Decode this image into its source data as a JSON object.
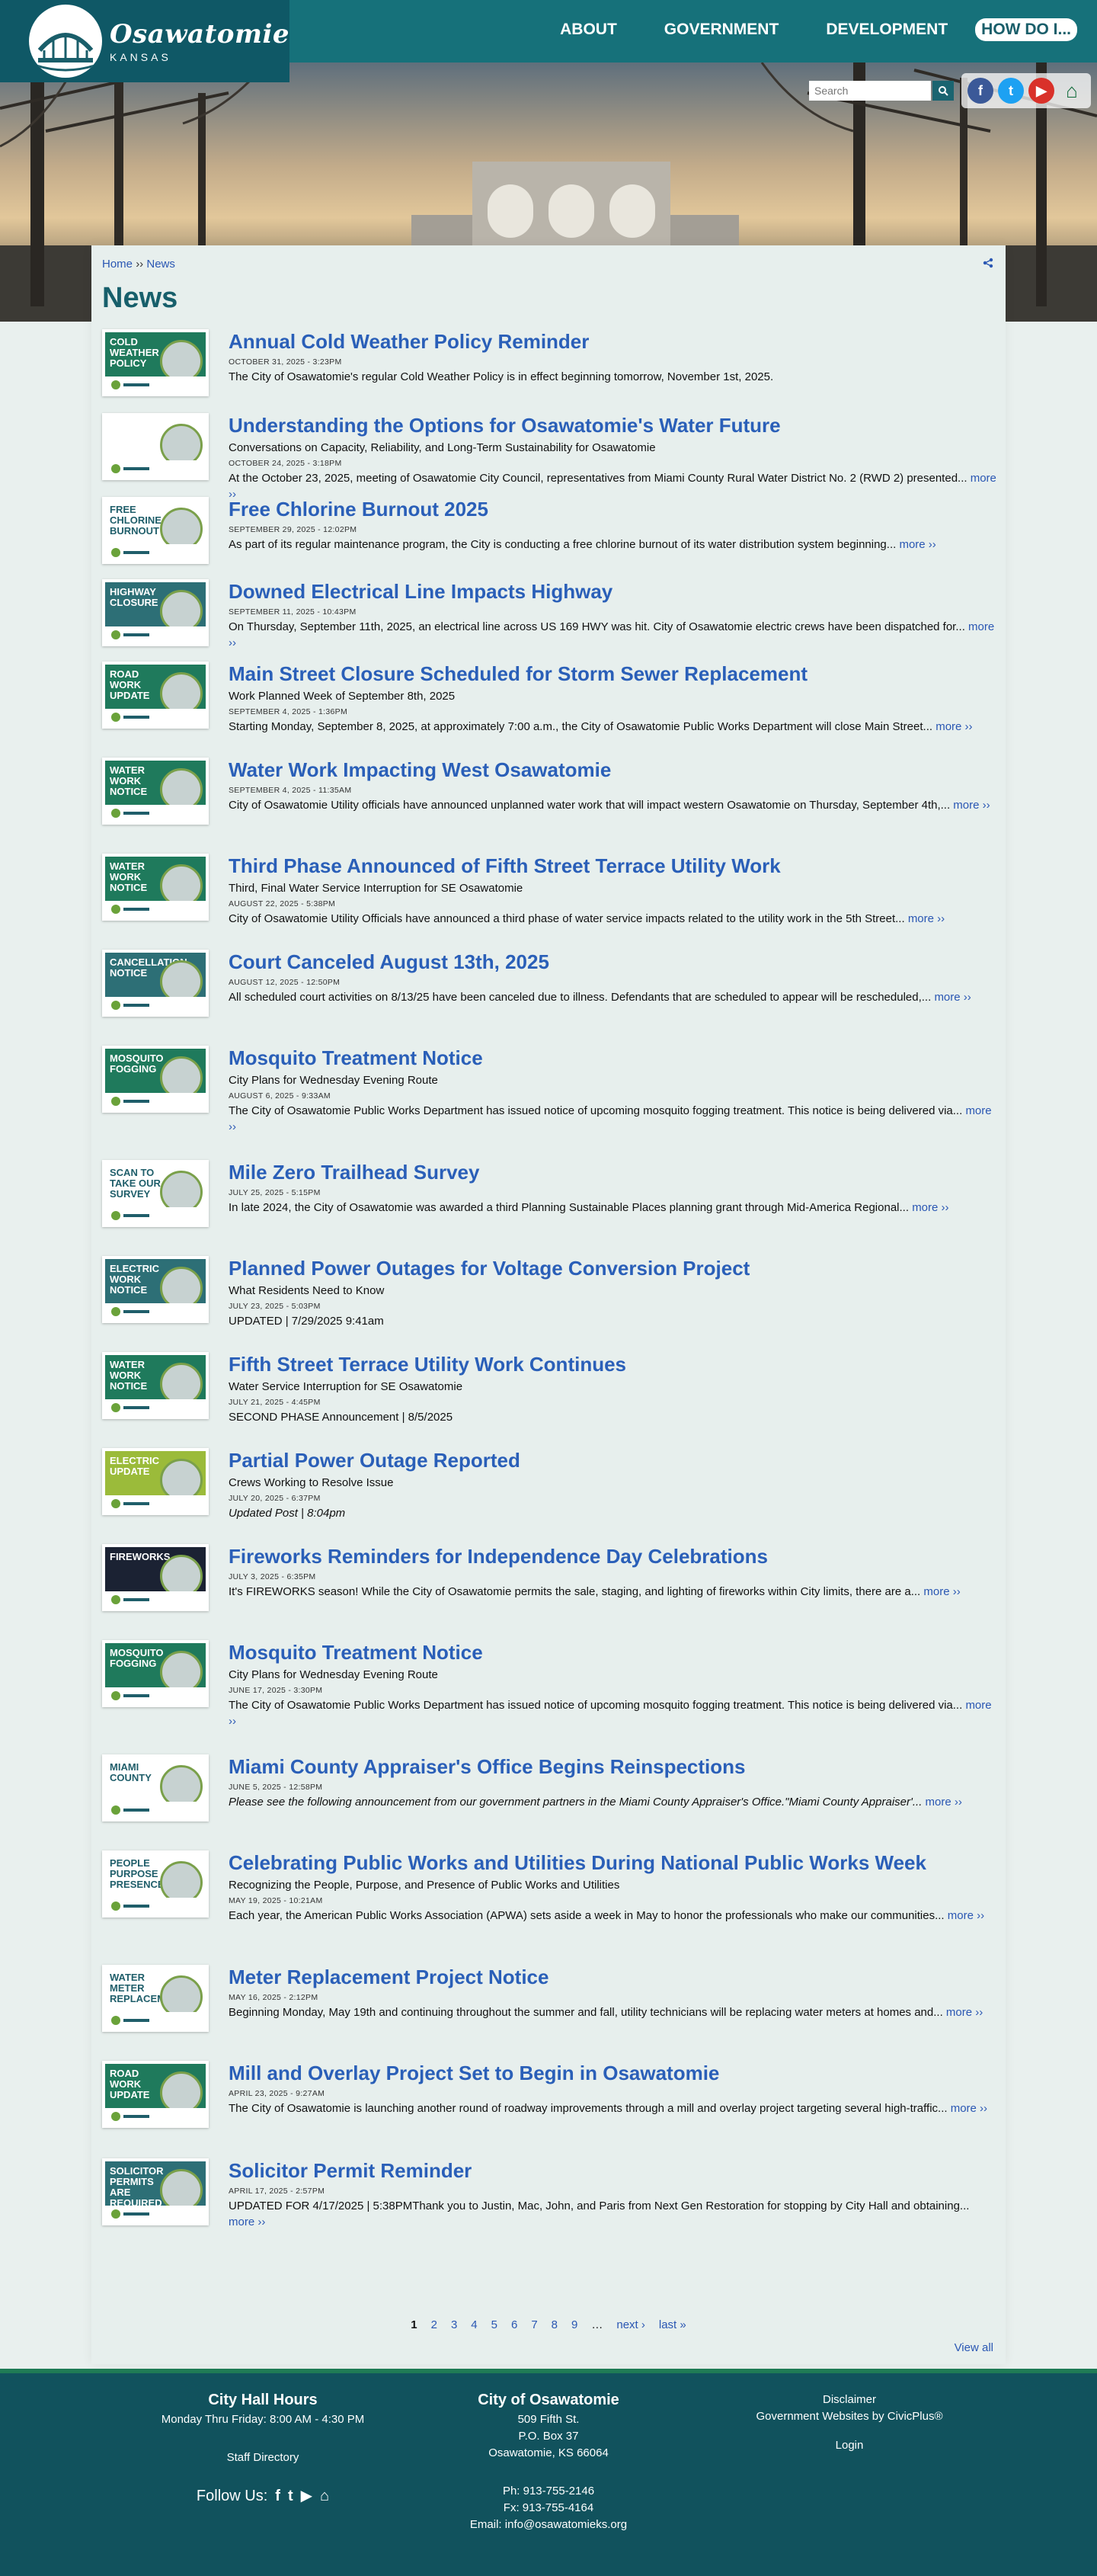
{
  "header": {
    "logo_name": "Osawatomie",
    "logo_sub": "KANSAS",
    "nav": [
      "ABOUT",
      "GOVERNMENT",
      "DEVELOPMENT",
      "HOW DO I..."
    ]
  },
  "search": {
    "placeholder": "Search"
  },
  "social": {
    "facebook": "f",
    "twitter": "t",
    "youtube": "▶",
    "home": "⌂"
  },
  "breadcrumb": {
    "home": "Home",
    "sep": "››",
    "current": "News"
  },
  "page_title": "News",
  "more_label": "more ››",
  "news": [
    {
      "title": "Annual Cold Weather Policy Reminder",
      "sub": "",
      "date": "OCTOBER 31, 2025 - 3:23PM",
      "text": "The City of Osawatomie's regular Cold Weather Policy is in effect beginning tomorrow, November 1st, 2025.",
      "more": false,
      "thumb": "COLD WEATHER POLICY"
    },
    {
      "title": "Understanding the Options for Osawatomie's Water Future",
      "sub": "Conversations on Capacity, Reliability, and Long-Term Sustainability for Osawatomie",
      "date": "OCTOBER 24, 2025 - 3:18PM",
      "text": "At the October 23, 2025, meeting of Osawatomie City Council, representatives from Miami County Rural Water District No. 2 (RWD 2) presented...",
      "more": true,
      "thumb": ""
    },
    {
      "title": "Free Chlorine Burnout 2025",
      "sub": "",
      "date": "SEPTEMBER 29, 2025 - 12:02PM",
      "text": "As part of its regular maintenance program, the City is conducting a free chlorine burnout of its water distribution system beginning...",
      "more": true,
      "thumb": "FREE CHLORINE BURNOUT"
    },
    {
      "title": "Downed Electrical Line Impacts Highway",
      "sub": "",
      "date": "SEPTEMBER 11, 2025 - 10:43PM",
      "text": "On Thursday, September 11th, 2025, an electrical line across US 169 HWY was hit. City of Osawatomie electric crews have been dispatched for...",
      "more": true,
      "thumb": "HIGHWAY CLOSURE"
    },
    {
      "title": "Main Street Closure Scheduled for Storm Sewer Replacement",
      "sub": "Work Planned Week of September 8th, 2025",
      "date": "SEPTEMBER 4, 2025 - 1:36PM",
      "text": "Starting Monday, September 8, 2025, at approximately 7:00 a.m., the City of Osawatomie Public Works Department will close Main Street...",
      "more": true,
      "thumb": "ROAD WORK UPDATE"
    },
    {
      "title": "Water Work Impacting West Osawatomie",
      "sub": "",
      "date": "SEPTEMBER 4, 2025 - 11:35AM",
      "text": "City of Osawatomie Utility officials have announced unplanned water work that will impact western Osawatomie on Thursday, September 4th,...",
      "more": true,
      "thumb": "WATER WORK NOTICE"
    },
    {
      "title": "Third Phase Announced of Fifth Street Terrace Utility Work",
      "sub": "Third, Final Water Service Interruption for SE Osawatomie",
      "date": "AUGUST 22, 2025 - 5:38PM",
      "text": "City of Osawatomie Utility Officials have announced a third phase of water service impacts related to the utility work in the 5th Street...",
      "more": true,
      "thumb": "WATER WORK NOTICE"
    },
    {
      "title": "Court Canceled August 13th, 2025",
      "sub": "",
      "date": "AUGUST 12, 2025 - 12:50PM",
      "text": "All scheduled court activities on 8/13/25 have been canceled due to illness. Defendants that are scheduled to appear will be rescheduled,...",
      "more": true,
      "thumb": "CANCELLATION NOTICE"
    },
    {
      "title": "Mosquito Treatment Notice",
      "sub": "City Plans for Wednesday Evening Route",
      "date": "AUGUST 6, 2025 - 9:33AM",
      "text": "The City of Osawatomie Public Works Department has issued notice of upcoming mosquito fogging treatment. This notice is being delivered via...",
      "more": true,
      "thumb": "MOSQUITO FOGGING"
    },
    {
      "title": "Mile Zero Trailhead Survey",
      "sub": "",
      "date": "JULY 25, 2025 - 5:15PM",
      "text": "In late 2024, the City of Osawatomie was awarded a third Planning Sustainable Places planning grant through Mid-America Regional...",
      "more": true,
      "thumb": "SCAN TO TAKE OUR SURVEY"
    },
    {
      "title": "Planned Power Outages for Voltage Conversion Project",
      "sub": "What Residents Need to Know",
      "date": "JULY 23, 2025 - 5:03PM",
      "text": "UPDATED | 7/29/2025 9:41am",
      "more": false,
      "thumb": "ELECTRIC WORK NOTICE"
    },
    {
      "title": "Fifth Street Terrace Utility Work Continues",
      "sub": "Water Service Interruption for SE Osawatomie",
      "date": "JULY 21, 2025 - 4:45PM",
      "text": "SECOND PHASE Announcement | 8/5/2025",
      "more": false,
      "thumb": "WATER WORK NOTICE"
    },
    {
      "title": "Partial Power Outage Reported",
      "sub": "Crews Working to Resolve Issue",
      "date": "JULY 20, 2025 - 6:37PM",
      "text": "Updated Post | 8:04pm",
      "more": false,
      "thumb": "ELECTRIC UPDATE"
    },
    {
      "title": "Fireworks Reminders for Independence Day Celebrations",
      "sub": "",
      "date": "JULY 3, 2025 - 6:35PM",
      "text": "It's FIREWORKS season! While the City of Osawatomie permits the sale, staging, and lighting of fireworks within City limits, there are a...",
      "more": true,
      "thumb": "FIREWORKS"
    },
    {
      "title": "Mosquito Treatment Notice",
      "sub": "City Plans for Wednesday Evening Route",
      "date": "JUNE 17, 2025 - 3:30PM",
      "text": "The City of Osawatomie Public Works Department has issued notice of upcoming mosquito fogging treatment. This notice is being delivered via...",
      "more": true,
      "thumb": "MOSQUITO FOGGING"
    },
    {
      "title": "Miami County Appraiser's Office Begins Reinspections",
      "sub": "",
      "date": "JUNE 5, 2025 - 12:58PM",
      "text": "Please see the following announcement from our government partners in the Miami County Appraiser's Office.\"Miami County Appraiser'...",
      "more": true,
      "thumb": "MIAMI COUNTY"
    },
    {
      "title": "Celebrating Public Works and Utilities During National Public Works Week",
      "sub": "Recognizing the People, Purpose, and Presence of Public Works and Utilities",
      "date": "MAY 19, 2025 - 10:21AM",
      "text": "Each year, the American Public Works Association (APWA) sets aside a week in May to honor the professionals who make our communities...",
      "more": true,
      "thumb": "PEOPLE PURPOSE PRESENCE"
    },
    {
      "title": "Meter Replacement Project Notice",
      "sub": "",
      "date": "MAY 16, 2025 - 2:12PM",
      "text": "Beginning Monday, May 19th and continuing throughout the summer and fall, utility technicians will be replacing water meters at homes and...",
      "more": true,
      "thumb": "WATER METER REPLACEMENT"
    },
    {
      "title": "Mill and Overlay Project Set to Begin in Osawatomie",
      "sub": "",
      "date": "APRIL 23, 2025 - 9:27AM",
      "text": "The City of Osawatomie is launching another round of roadway improvements through a mill and overlay project targeting several high-traffic...",
      "more": true,
      "thumb": "ROAD WORK UPDATE"
    },
    {
      "title": "Solicitor Permit Reminder",
      "sub": "",
      "date": "APRIL 17, 2025 - 2:57PM",
      "text": "UPDATED FOR 4/17/2025 | 5:38PMThank you to Justin, Mac, John, and Paris from Next Gen Restoration for stopping by City Hall and obtaining...",
      "more": true,
      "thumb": "Solicitor Permits Are REQUIRED"
    }
  ],
  "pager": {
    "pages": [
      "1",
      "2",
      "3",
      "4",
      "5",
      "6",
      "7",
      "8",
      "9"
    ],
    "ellipsis": "…",
    "next": "next ›",
    "last": "last »",
    "view_all": "View all"
  },
  "footer": {
    "hours_title": "City Hall Hours",
    "hours": "Monday Thru Friday: 8:00 AM - 4:30 PM",
    "staff": "Staff Directory",
    "follow": "Follow Us:",
    "city_title": "City of Osawatomie",
    "addr1": "509 Fifth St.",
    "addr2": "P.O. Box 37",
    "addr3": "Osawatomie, KS 66064",
    "phone": "Ph: 913-755-2146",
    "fax": "Fx: 913-755-4164",
    "email": "Email: info@osawatomieks.org",
    "disclaimer": "Disclaimer",
    "civic": "Government Websites by CivicPlus®",
    "login": "Login"
  }
}
